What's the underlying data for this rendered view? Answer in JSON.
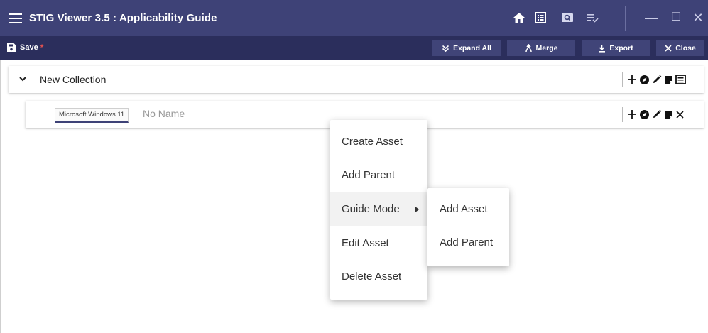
{
  "app": {
    "title": "STIG Viewer 3.5 : Applicability Guide"
  },
  "window_controls": {
    "minimize": "—",
    "maximize": "☐",
    "close": "✕"
  },
  "toolbar": {
    "save_label": "Save",
    "unsaved_marker": "*",
    "expand_all_label": "Expand All",
    "merge_label": "Merge",
    "export_label": "Export",
    "close_label": "Close"
  },
  "collection": {
    "label": "New Collection",
    "expanded": true
  },
  "asset": {
    "os_chip": "Microsoft Windows 11",
    "name": "No Name"
  },
  "context_menu": {
    "items": [
      "Create Asset",
      "Add Parent",
      "Guide Mode",
      "Edit Asset",
      "Delete Asset"
    ],
    "active_item": "Guide Mode"
  },
  "submenu": {
    "items": [
      "Add Asset",
      "Add Parent"
    ]
  },
  "colors": {
    "titlebar": "#3e4277",
    "toolbar": "#2b2e5c",
    "button": "#404478",
    "unsaved": "#e05050"
  }
}
